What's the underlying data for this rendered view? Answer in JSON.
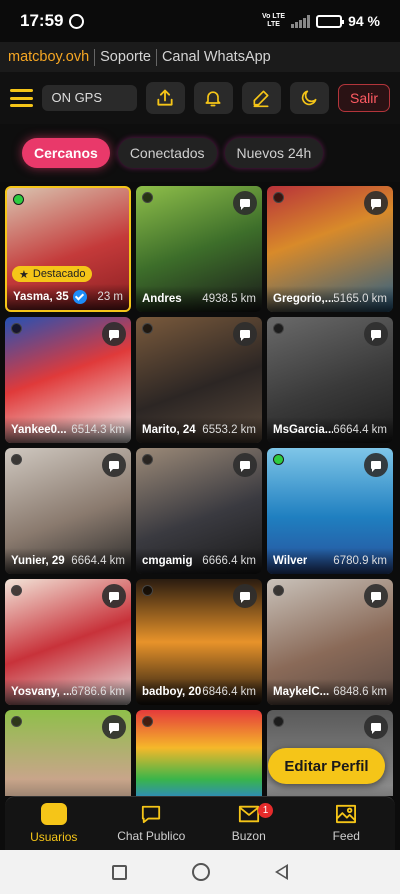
{
  "status_bar": {
    "time": "17:59",
    "network": "Vo LTE",
    "network_sub": "LTE",
    "battery": "94 %",
    "battery_level": 0.94
  },
  "links": {
    "brand": "matcboy.ovh",
    "support": "Soporte",
    "whatsapp": "Canal WhatsApp"
  },
  "toolbar": {
    "gps_placeholder": "ON GPS",
    "logout_label": "Salir"
  },
  "tabs": [
    {
      "label": "Cercanos",
      "active": true
    },
    {
      "label": "Conectados",
      "active": false
    },
    {
      "label": "Nuevos 24h",
      "active": false
    }
  ],
  "featured_label": "Destacado",
  "users": [
    {
      "name": "Yasma, 35",
      "distance": "23 m",
      "online": true,
      "verified": true,
      "featured": true,
      "message_icon": false,
      "bg": "linear-gradient(160deg,#d9c4b0 0%,#c43a3a 55%,#8a1f22 100%)"
    },
    {
      "name": "Andres",
      "distance": "4938.5 km",
      "online": false,
      "message_icon": true,
      "bg": "linear-gradient(160deg,#8fbf4a 0%,#3d6e2a 50%,#1b1b1b 100%)"
    },
    {
      "name": "Gregorio,...",
      "distance": "5165.0 km",
      "online": false,
      "message_icon": true,
      "bg": "linear-gradient(160deg,#b8323a 0%,#d88a2a 40%,#2b5f86 100%)"
    },
    {
      "name": "Yankee0...",
      "distance": "6514.3 km",
      "online": false,
      "message_icon": true,
      "bg": "linear-gradient(160deg,#2351b5 0%,#e03a3a 45%,#f4f4f4 100%)"
    },
    {
      "name": "Marito, 24",
      "distance": "6553.2 km",
      "online": false,
      "message_icon": true,
      "bg": "linear-gradient(160deg,#7a5a3c 0%,#2c2624 55%,#5a4a3c 100%)"
    },
    {
      "name": "MsGarcia...",
      "distance": "6664.4 km",
      "online": false,
      "message_icon": true,
      "bg": "linear-gradient(160deg,#6a6a6a 0%,#3a3a3a 55%,#1c1c1c 100%)"
    },
    {
      "name": "Yunier, 29",
      "distance": "6664.4 km",
      "online": false,
      "message_icon": true,
      "bg": "linear-gradient(160deg,#cfc8c0 0%,#8a7a6e 55%,#2a2a2a 100%)"
    },
    {
      "name": "cmgamig",
      "distance": "6666.4 km",
      "online": false,
      "message_icon": true,
      "bg": "linear-gradient(160deg,#9c8a78 0%,#3a3a40 55%,#1a1a1a 100%)"
    },
    {
      "name": "Wilver",
      "distance": "6780.9 km",
      "online": true,
      "message_icon": true,
      "bg": "linear-gradient(180deg,#7fc6e8 0%,#1f7fc0 55%,#2a4f9a 100%)"
    },
    {
      "name": "Yosvany, ...",
      "distance": "6786.6 km",
      "online": false,
      "message_icon": true,
      "bg": "linear-gradient(160deg,#f2e4d8 0%,#c8323a 50%,#e8e0e0 100%)"
    },
    {
      "name": "badboy, 20",
      "distance": "6846.4 km",
      "online": false,
      "message_icon": true,
      "bg": "linear-gradient(180deg,#2b1c10 0%,#e8932a 50%,#1a1410 100%)"
    },
    {
      "name": "MaykelC...",
      "distance": "6848.6 km",
      "online": false,
      "message_icon": true,
      "bg": "linear-gradient(160deg,#c9c2ba 0%,#8a6a58 55%,#5a4a44 100%)"
    },
    {
      "name": "",
      "distance": "",
      "online": false,
      "message_icon": true,
      "bg": "linear-gradient(180deg,#8fbf4a 0%,#c8a58a 55%,#3a3a3a 100%)"
    },
    {
      "name": "",
      "distance": "",
      "online": false,
      "message_icon": false,
      "bg": "linear-gradient(180deg,#e53b3b 0%,#f5b82a 30%,#3ab54a 55%,#2a7be4 75%,#8a3ab5 100%)"
    },
    {
      "name": "",
      "distance": "",
      "online": false,
      "message_icon": true,
      "bg": "linear-gradient(180deg,#5a5a5a 0%,#8a8a8a 60%,#3a3a3a 100%)"
    }
  ],
  "edit_profile_label": "Editar Perfil",
  "bottom_nav": [
    {
      "label": "Usuarios",
      "active": true,
      "icon": "users-icon"
    },
    {
      "label": "Chat Publico",
      "active": false,
      "icon": "chat-icon"
    },
    {
      "label": "Buzon",
      "active": false,
      "icon": "mail-icon",
      "badge": "1"
    },
    {
      "label": "Feed",
      "active": false,
      "icon": "image-icon"
    }
  ]
}
